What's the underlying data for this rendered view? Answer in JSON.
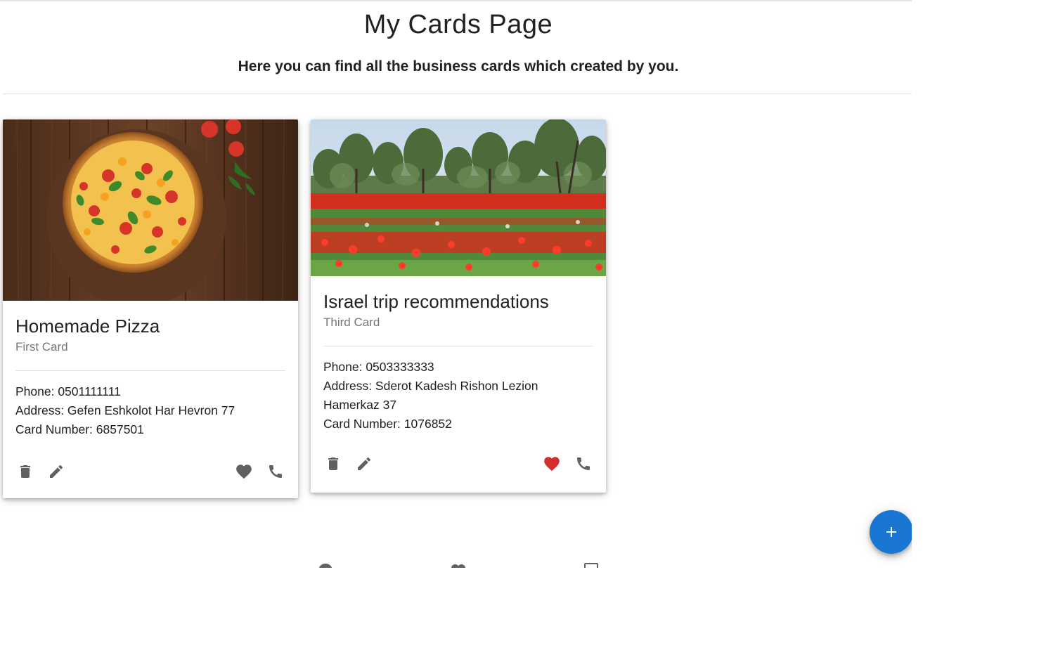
{
  "page": {
    "title": "My Cards Page",
    "subtitle": "Here you can find all the business cards which created by you."
  },
  "cards": [
    {
      "title": "Homemade Pizza",
      "subtitle": "First Card",
      "phone": "Phone: 0501111111",
      "address": "Address: Gefen Eshkolot Har Hevron 77",
      "card_number": "Card Number: 6857501",
      "image": "pizza-image",
      "liked": false
    },
    {
      "title": "Israel trip recommendations",
      "subtitle": "Third Card",
      "phone": "Phone: 0503333333",
      "address": "Address: Sderot Kadesh Rishon Lezion Hamerkaz 37",
      "card_number": "Card Number: 1076852",
      "image": "red-flower-field-image",
      "liked": true
    }
  ],
  "icons": {
    "delete": "trash-icon",
    "edit": "pencil-icon",
    "like": "heart-icon",
    "call": "phone-icon",
    "add": "plus-icon"
  },
  "colors": {
    "icon_gray": "#616161",
    "liked_red": "#d32f2f",
    "fab_blue": "#1976d2"
  }
}
